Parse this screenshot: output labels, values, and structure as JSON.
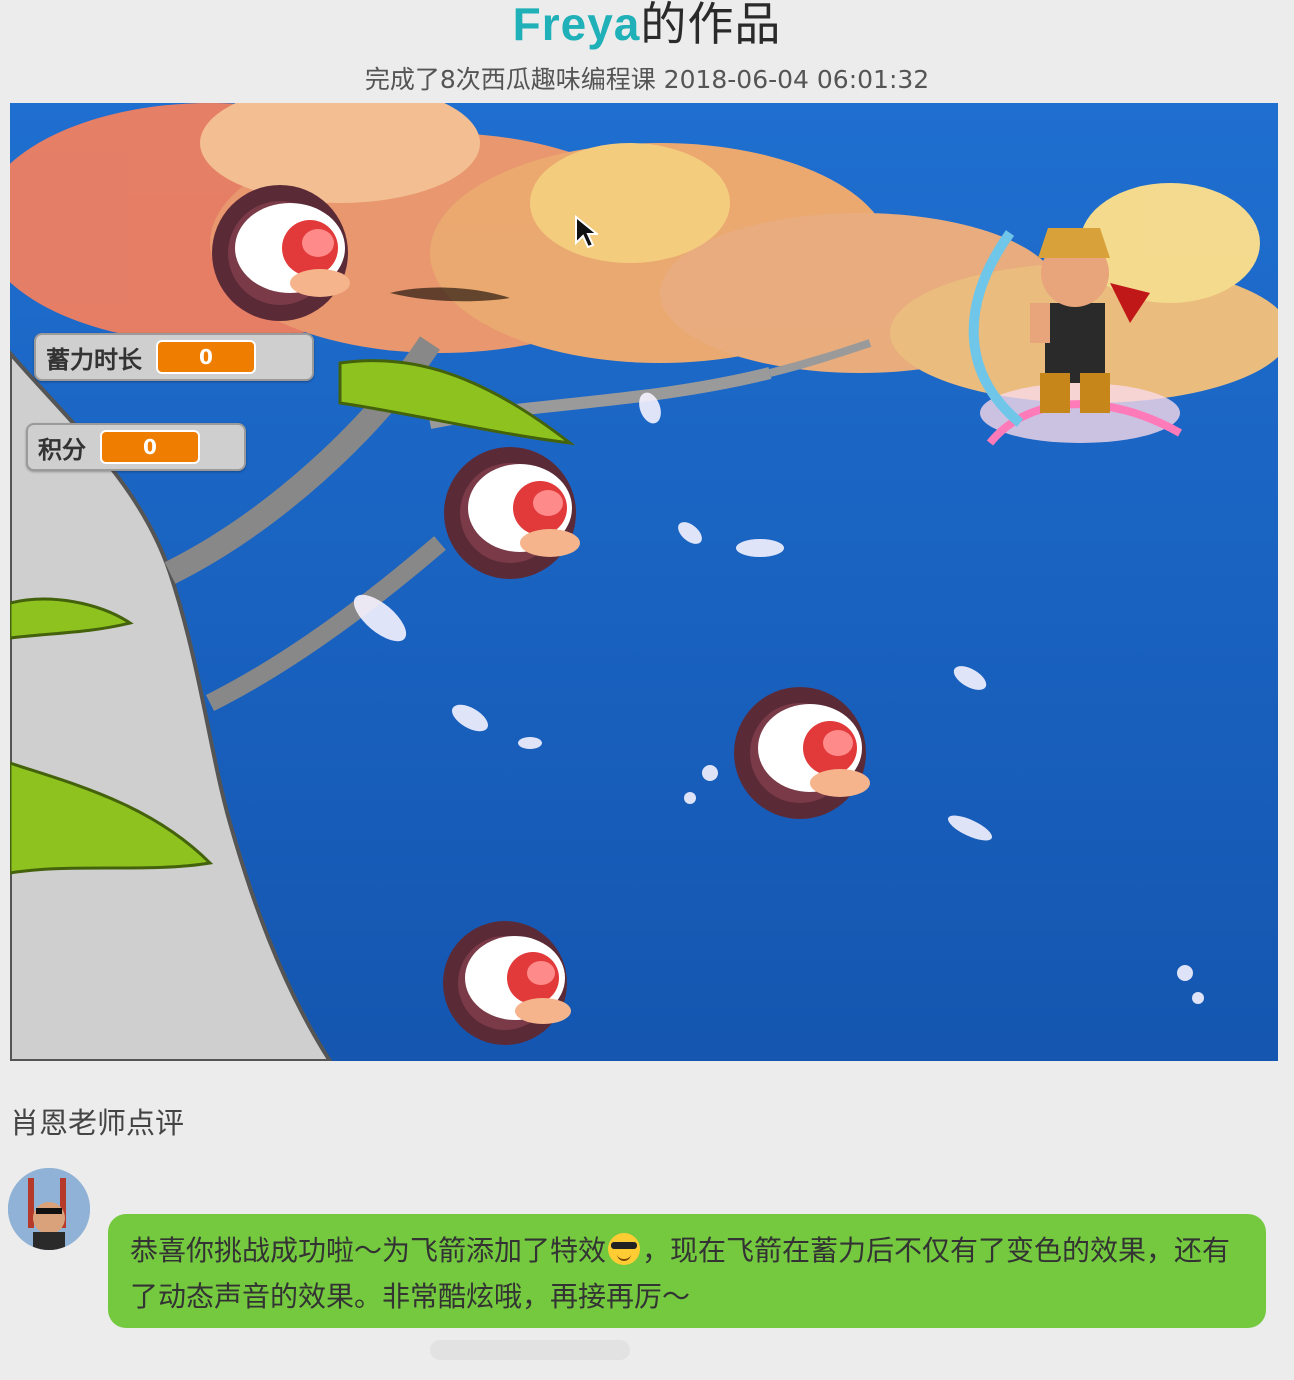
{
  "header": {
    "author": "Freya",
    "title_suffix": "的作品",
    "subtitle": "完成了8次西瓜趣味编程课 2018-06-04 06:01:32"
  },
  "game": {
    "monitors": [
      {
        "label": "蓄力时长",
        "value": "0"
      },
      {
        "label": "积分",
        "value": "0"
      }
    ]
  },
  "review": {
    "title": "肖恩老师点评",
    "comment_part1": "恭喜你挑战成功啦～为飞箭添加了特效",
    "emoji": "smiling-face-with-sunglasses-icon",
    "comment_part2": "，现在飞箭在蓄力后不仅有了变色的效果，还有了动态声音的效果。非常酷炫哦，再接再厉～"
  },
  "colors": {
    "accent": "#1fb0b8",
    "bubble": "#74c93f",
    "monitor_value": "#ee7d00",
    "sky": "#1a67c4"
  }
}
